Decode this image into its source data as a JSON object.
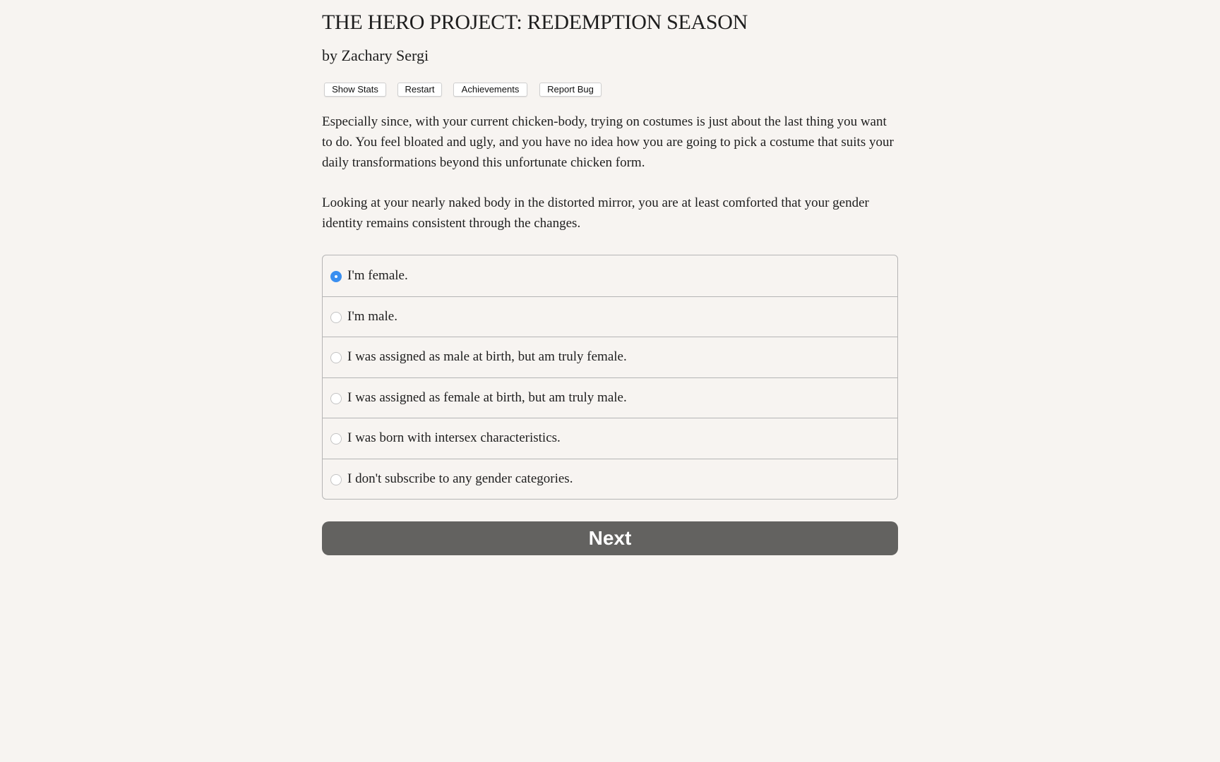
{
  "header": {
    "title": "THE HERO PROJECT: REDEMPTION SEASON",
    "author": "by Zachary Sergi"
  },
  "toolbar": {
    "buttons": [
      {
        "label": "Show Stats"
      },
      {
        "label": "Restart"
      },
      {
        "label": "Achievements"
      },
      {
        "label": "Report Bug"
      }
    ]
  },
  "story": {
    "paragraphs": [
      "Especially since, with your current chicken-body, trying on costumes is just about the last thing you want to do. You feel bloated and ugly, and you have no idea how you are going to pick a costume that suits your daily transformations beyond this unfortunate chicken form.",
      "Looking at your nearly naked body in the distorted mirror, you are at least comforted that your gender identity remains consistent through the changes."
    ]
  },
  "choices": {
    "selected_index": 0,
    "options": [
      {
        "label": "I'm female.",
        "selected": true
      },
      {
        "label": "I'm male.",
        "selected": false
      },
      {
        "label": "I was assigned as male at birth, but am truly female.",
        "selected": false
      },
      {
        "label": "I was assigned as female at birth, but am truly male.",
        "selected": false
      },
      {
        "label": "I was born with intersex characteristics.",
        "selected": false
      },
      {
        "label": "I don't subscribe to any gender categories.",
        "selected": false
      }
    ]
  },
  "next_button": {
    "label": "Next"
  },
  "colors": {
    "background": "#f7f4f1",
    "text": "#1e1e1e",
    "radio_selected": "#3a8ff0",
    "next_button_bg": "#636260",
    "border": "#b5b5b5"
  }
}
